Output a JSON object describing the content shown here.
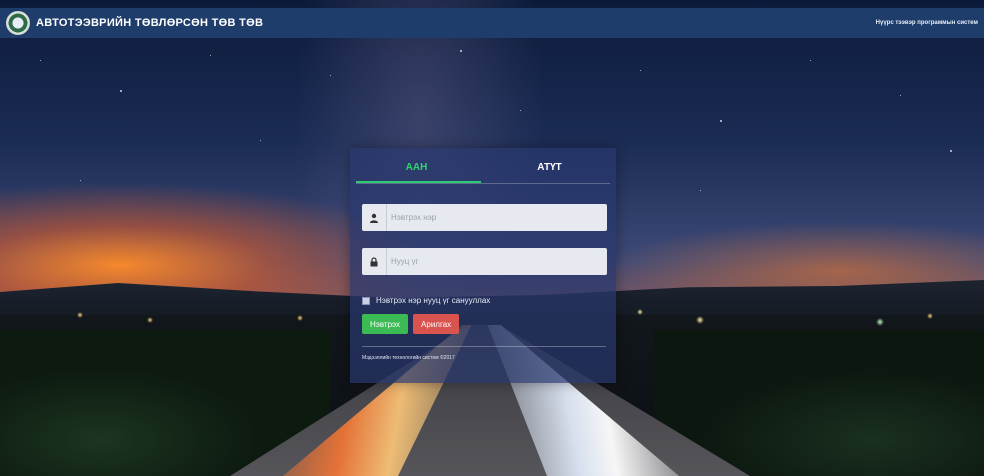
{
  "header": {
    "title": "АВТОТЭЭВРИЙН ТӨВЛӨРСӨН ТӨВ ТӨВ",
    "right_text": "Нүүрс тээвэр программын систем"
  },
  "login": {
    "tabs": [
      {
        "label": "ААН",
        "active": true
      },
      {
        "label": "АТҮТ",
        "active": false
      }
    ],
    "username_placeholder": "Нэвтрэх нэр",
    "password_placeholder": "Нууц үг",
    "remember_label": "Нэвтрэх нэр нууц үг санууллах",
    "login_button": "Нэвтрэх",
    "cancel_button": "Арилгах",
    "footer": "Мэдээллийн технологийн систем ©2017"
  },
  "colors": {
    "topbar": "#1f3d6b",
    "active_tab": "#2fd46c",
    "login_button": "#3cba54",
    "cancel_button": "#d9534f"
  },
  "icons": [
    "logo-emblem",
    "user-icon",
    "lock-icon"
  ]
}
